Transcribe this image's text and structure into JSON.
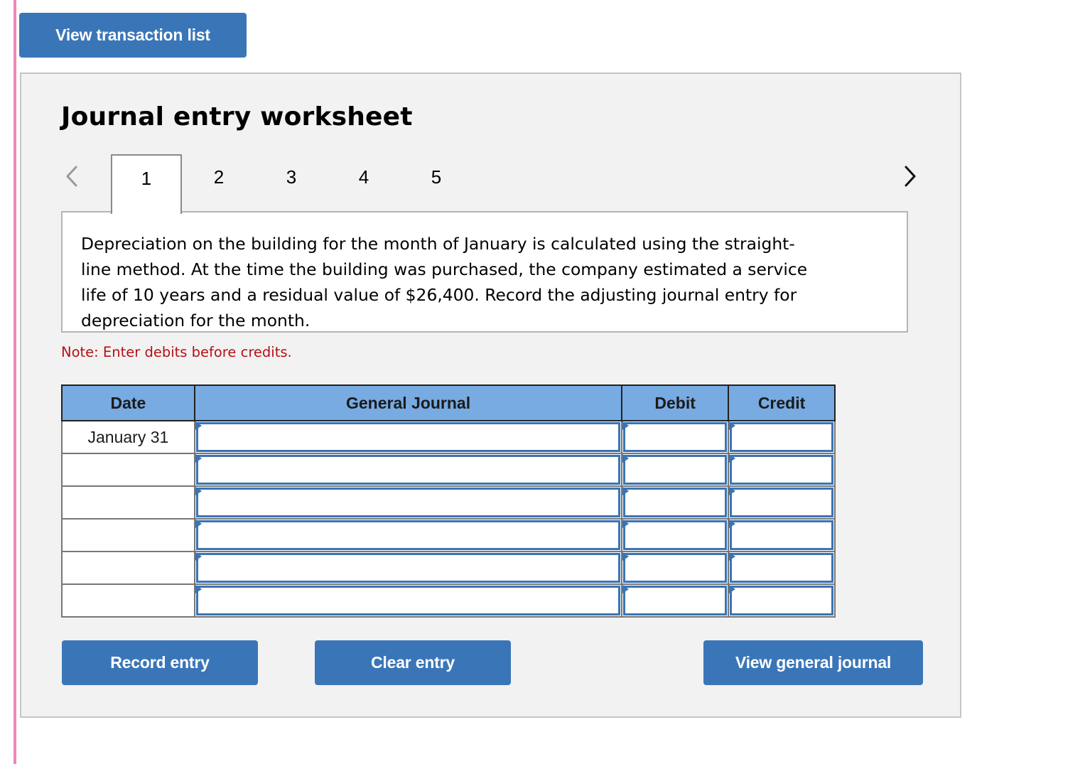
{
  "top_button": {
    "label": "View transaction list"
  },
  "worksheet": {
    "title": "Journal entry worksheet",
    "nav": {
      "prev_icon": "chevron-left-icon",
      "next_icon": "chevron-right-icon"
    },
    "tabs": [
      {
        "label": "1",
        "active": true
      },
      {
        "label": "2",
        "active": false
      },
      {
        "label": "3",
        "active": false
      },
      {
        "label": "4",
        "active": false
      },
      {
        "label": "5",
        "active": false
      }
    ],
    "description": "Depreciation on the building for the month of January is calculated using the straight-line method. At the time the building was purchased, the company estimated a service life of 10 years and a residual value of $26,400. Record the adjusting journal entry for depreciation for the month.",
    "note": "Note: Enter debits before credits.",
    "table": {
      "headers": {
        "date": "Date",
        "general_journal": "General Journal",
        "debit": "Debit",
        "credit": "Credit"
      },
      "rows": [
        {
          "date": "January 31",
          "account": "",
          "debit": "",
          "credit": ""
        },
        {
          "date": "",
          "account": "",
          "debit": "",
          "credit": ""
        },
        {
          "date": "",
          "account": "",
          "debit": "",
          "credit": ""
        },
        {
          "date": "",
          "account": "",
          "debit": "",
          "credit": ""
        },
        {
          "date": "",
          "account": "",
          "debit": "",
          "credit": ""
        },
        {
          "date": "",
          "account": "",
          "debit": "",
          "credit": ""
        }
      ]
    },
    "buttons": {
      "record": "Record entry",
      "clear": "Clear entry",
      "view_general_journal": "View general journal"
    }
  },
  "colors": {
    "button_blue": "#3a76b7",
    "header_blue": "#77abe1",
    "note_red": "#b70f14",
    "panel_bg": "#f2f2f2",
    "left_bar_pink": "#ee86b9"
  }
}
